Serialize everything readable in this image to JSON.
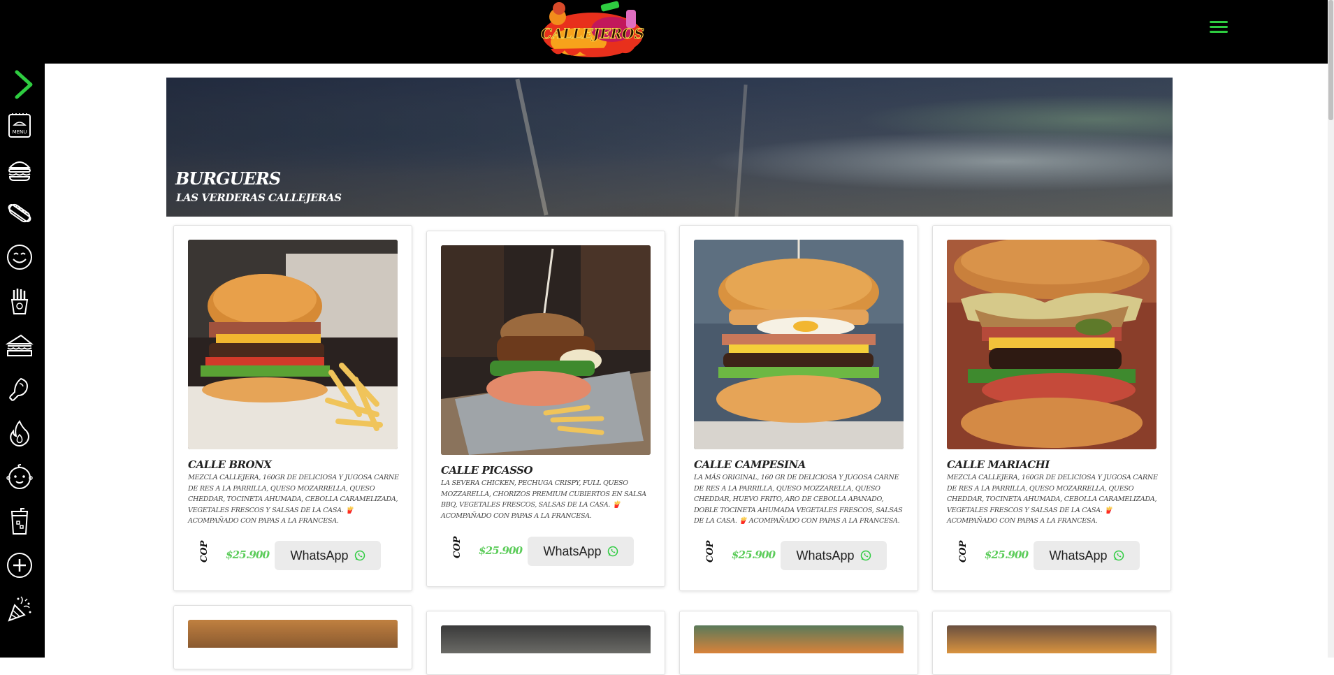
{
  "header": {
    "logo_text": "CALLEJEROS",
    "menu_icon": "hamburger-icon",
    "accent_color": "#2ecc40"
  },
  "sidebar": {
    "toggle_icon": "chevron-right-icon",
    "items": [
      {
        "icon": "menu-board-icon",
        "label": "MENU"
      },
      {
        "icon": "burger-icon"
      },
      {
        "icon": "hotdog-icon"
      },
      {
        "icon": "smiley-icon"
      },
      {
        "icon": "fries-icon"
      },
      {
        "icon": "sandwich-icon"
      },
      {
        "icon": "drumstick-icon"
      },
      {
        "icon": "flame-icon"
      },
      {
        "icon": "baby-face-icon"
      },
      {
        "icon": "drink-icon"
      },
      {
        "icon": "plus-circle-icon"
      },
      {
        "icon": "party-popper-icon"
      }
    ]
  },
  "banner": {
    "title": "BURGUERS",
    "subtitle": "LAS VERDERAS CALLEJERAS"
  },
  "products": [
    {
      "name": "CALLE BRONX",
      "description": "MEZCLA CALLEJERA, 160GR DE DELICIOSA Y JUGOSA CARNE DE RES A LA PARRILLA, QUESO MOZARRELLA, QUESO CHEDDAR, TOCINETA AHUMADA, CEBOLLA CARAMELIZADA, VEGETALES FRESCOS Y SALSAS DE LA CASA. 🍟 ACOMPAÑADO CON PAPAS A LA FRANCESA.",
      "currency": "COP",
      "price": "$25.900",
      "button_label": "WhatsApp"
    },
    {
      "name": "CALLE PICASSO",
      "description": "LA SEVERA CHICKEN, PECHUGA CRISPY, FULL QUESO MOZZARELLA, CHORIZOS PREMIUM CUBIERTOS EN SALSA BBQ, VEGETALES FRESCOS, SALSAS DE LA CASA. 🍟 ACOMPAÑADO CON PAPAS A LA FRANCESA.",
      "currency": "COP",
      "price": "$25.900",
      "button_label": "WhatsApp"
    },
    {
      "name": "CALLE CAMPESINA",
      "description": "LA MÁS ORIGINAL, 160 GR DE DELICIOSA Y JUGOSA CARNE DE RES A LA PARRILLA, QUESO MOZZARELLA, QUESO CHEDDAR, HUEVO FRITO, ARO DE CEBOLLA APANADO, DOBLE TOCINETA AHUMADA VEGETALES FRESCOS, SALSAS DE LA CASA. 🍟 ACOMPAÑADO CON PAPAS A LA FRANCESA.",
      "currency": "COP",
      "price": "$25.900",
      "button_label": "WhatsApp"
    },
    {
      "name": "CALLE MARIACHI",
      "description": "MEZCLA CALLEJERA, 160GR DE DELICIOSA Y JUGOSA CARNE DE RES A LA PARRILLA, QUESO MOZARRELLA, QUESO CHEDDAR, TOCINETA AHUMADA, CEBOLLA CARAMELIZADA, VEGETALES FRESCOS Y SALSAS DE LA CASA. 🍟 ACOMPAÑADO CON PAPAS A LA FRANCESA.",
      "currency": "COP",
      "price": "$25.900",
      "button_label": "WhatsApp"
    }
  ]
}
